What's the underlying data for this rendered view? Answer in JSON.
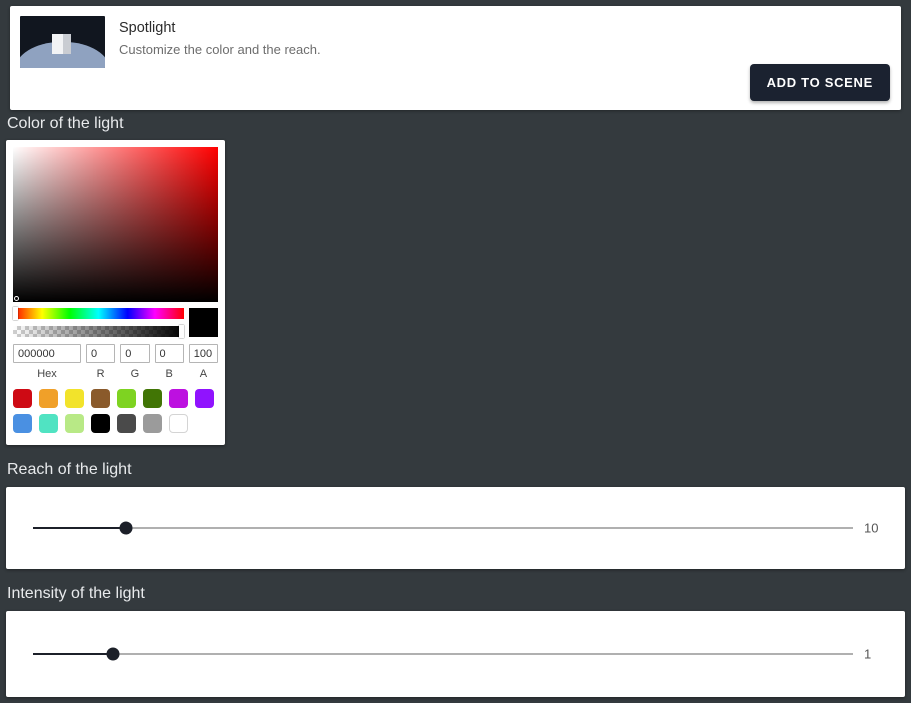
{
  "header": {
    "thumbnail_alt": "spotlight-preview-thumbnail",
    "title": "Spotlight",
    "subtitle": "Customize the color and the reach.",
    "add_button_label": "ADD TO SCENE",
    "add_button_color": "#1b2230"
  },
  "sections": {
    "color": {
      "heading": "Color of the light"
    },
    "reach": {
      "heading": "Reach of the light"
    },
    "intensity": {
      "heading": "Intensity of the light"
    }
  },
  "color_picker": {
    "current_color_hex": "#000000",
    "gradient_hue_color": "#ff0000",
    "fields": [
      {
        "name": "hex",
        "label": "Hex",
        "value": "000000",
        "placeholder": "000000"
      },
      {
        "name": "red",
        "label": "R",
        "value": "0",
        "placeholder": "0"
      },
      {
        "name": "green",
        "label": "G",
        "value": "0",
        "placeholder": "0"
      },
      {
        "name": "blue",
        "label": "B",
        "value": "0",
        "placeholder": "0"
      },
      {
        "name": "alpha",
        "label": "A",
        "value": "100",
        "placeholder": "100"
      }
    ],
    "hue_slider_position_percent": 0,
    "alpha_slider_position_percent": 100,
    "presets_row_1": [
      {
        "name": "crimson",
        "hex": "#ce0a14"
      },
      {
        "name": "orange",
        "hex": "#f0a029"
      },
      {
        "name": "yellow",
        "hex": "#f2e32b"
      },
      {
        "name": "brown",
        "hex": "#8a5a2b"
      },
      {
        "name": "light-green",
        "hex": "#7ed321"
      },
      {
        "name": "dark-green",
        "hex": "#417505"
      },
      {
        "name": "magenta",
        "hex": "#bd10e0"
      },
      {
        "name": "purple",
        "hex": "#9013fe"
      }
    ],
    "presets_row_2": [
      {
        "name": "blue",
        "hex": "#4a90e2"
      },
      {
        "name": "turquoise",
        "hex": "#50e3c2"
      },
      {
        "name": "pale-green",
        "hex": "#b8e986"
      },
      {
        "name": "black",
        "hex": "#000000"
      },
      {
        "name": "dark-gray",
        "hex": "#4a4a4a"
      },
      {
        "name": "gray",
        "hex": "#9b9b9b"
      },
      {
        "name": "white",
        "hex": "#ffffff"
      }
    ]
  },
  "sliders": {
    "reach": {
      "value": "10",
      "thumb_percent": 11.3,
      "track_color": "#b0b0b0",
      "fill_color": "#1c2029"
    },
    "intensity": {
      "value": "1",
      "thumb_percent": 9.8,
      "track_color": "#b0b0b0",
      "fill_color": "#1c2029"
    }
  },
  "theme": {
    "page_background": "#343a3e",
    "card_background": "#ffffff",
    "heading_color": "#e8eaec"
  }
}
